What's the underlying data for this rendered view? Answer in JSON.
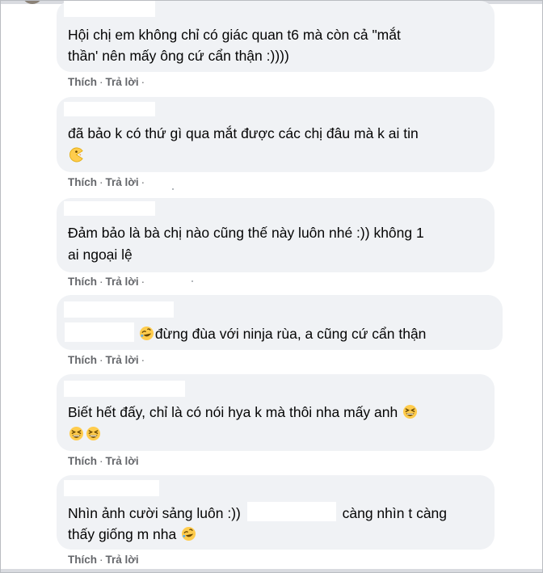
{
  "comments": [
    {
      "line1": "Hội chị em không chỉ có giác quan t6 mà còn cả \"mắt",
      "line2": "thần' nên mấy ông cứ cẩn thận :))))",
      "like": "Thích",
      "reply": "Trả lời",
      "sep": "·"
    },
    {
      "line1": "đã bảo k có thứ gì qua mắt được các chị đâu mà k ai tin",
      "emoji": "pacman-emoji",
      "like": "Thích",
      "reply": "Trả lời",
      "sep": "·"
    },
    {
      "line1": "Đảm bảo là bà chị nào cũng thế này luôn nhé :)) không 1",
      "line2": "ai ngoại lệ",
      "like": "Thích",
      "reply": "Trả lời",
      "sep": "·"
    },
    {
      "line1": "đừng đùa với ninja rùa, a cũng cứ cẩn thận",
      "emoji": "rolling-laughing-emoji",
      "like": "Thích",
      "reply": "Trả lời",
      "sep": "·"
    },
    {
      "line1": "Biết hết đấy, chỉ là có nói hya k mà thôi nha mấy anh",
      "emoji": "grinning-squinting-emoji",
      "like": "Thích",
      "reply": "Trả lời",
      "sep": "·"
    },
    {
      "line1_a": "Nhìn ảnh cười sảng luôn :))",
      "line1_b": "càng nhìn t càng",
      "line2": "thấy giống m nha",
      "emoji": "rolling-laughing-emoji",
      "like": "Thích",
      "reply": "Trả lời",
      "sep": ""
    }
  ],
  "colors": {
    "bubble": "#f0f2f5",
    "text": "#050505",
    "action": "#65676b",
    "emoji_yellow": "#ffcc4d",
    "emoji_dark": "#664500"
  }
}
